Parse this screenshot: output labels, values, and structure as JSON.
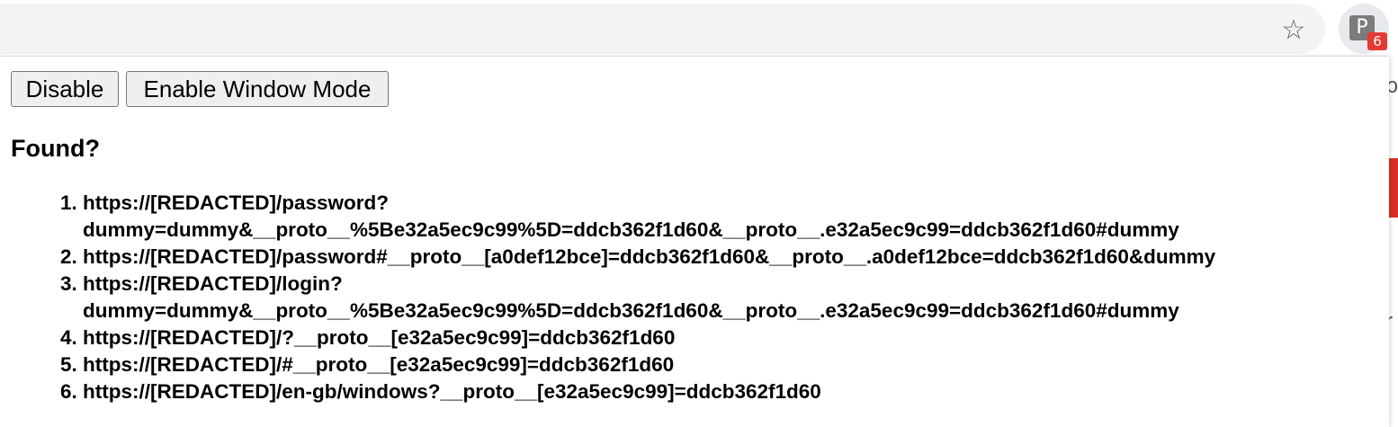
{
  "browser": {
    "extension_badge": "6",
    "extension_letter": "P",
    "icons": {
      "bookmark": "star-outline-icon",
      "extension": "extension-p-icon"
    }
  },
  "popup": {
    "buttons": {
      "disable": "Disable",
      "window_mode": "Enable Window Mode"
    },
    "heading": "Found?",
    "results": [
      {
        "line1": "https://[REDACTED]/password?",
        "line2": "dummy=dummy&__proto__%5Be32a5ec9c99%5D=ddcb362f1d60&__proto__.e32a5ec9c99=ddcb362f1d60#dummy"
      },
      {
        "line1": "https://[REDACTED]/password#__proto__[a0def12bce]=ddcb362f1d60&__proto__.a0def12bce=ddcb362f1d60&dummy",
        "line2": ""
      },
      {
        "line1": "https://[REDACTED]/login?",
        "line2": "dummy=dummy&__proto__%5Be32a5ec9c99%5D=ddcb362f1d60&__proto__.e32a5ec9c99=ddcb362f1d60#dummy"
      },
      {
        "line1": "https://[REDACTED]/?__proto__[e32a5ec9c99]=ddcb362f1d60",
        "line2": ""
      },
      {
        "line1": "https://[REDACTED]/#__proto__[e32a5ec9c99]=ddcb362f1d60",
        "line2": ""
      },
      {
        "line1": "https://[REDACTED]/en-gb/windows?__proto__[e32a5ec9c99]=ddcb362f1d60",
        "line2": ""
      }
    ]
  },
  "colors": {
    "omnibox_bg": "#f1f3f4",
    "badge_bg": "#e53935",
    "page_red_fragment": "#d93025"
  }
}
